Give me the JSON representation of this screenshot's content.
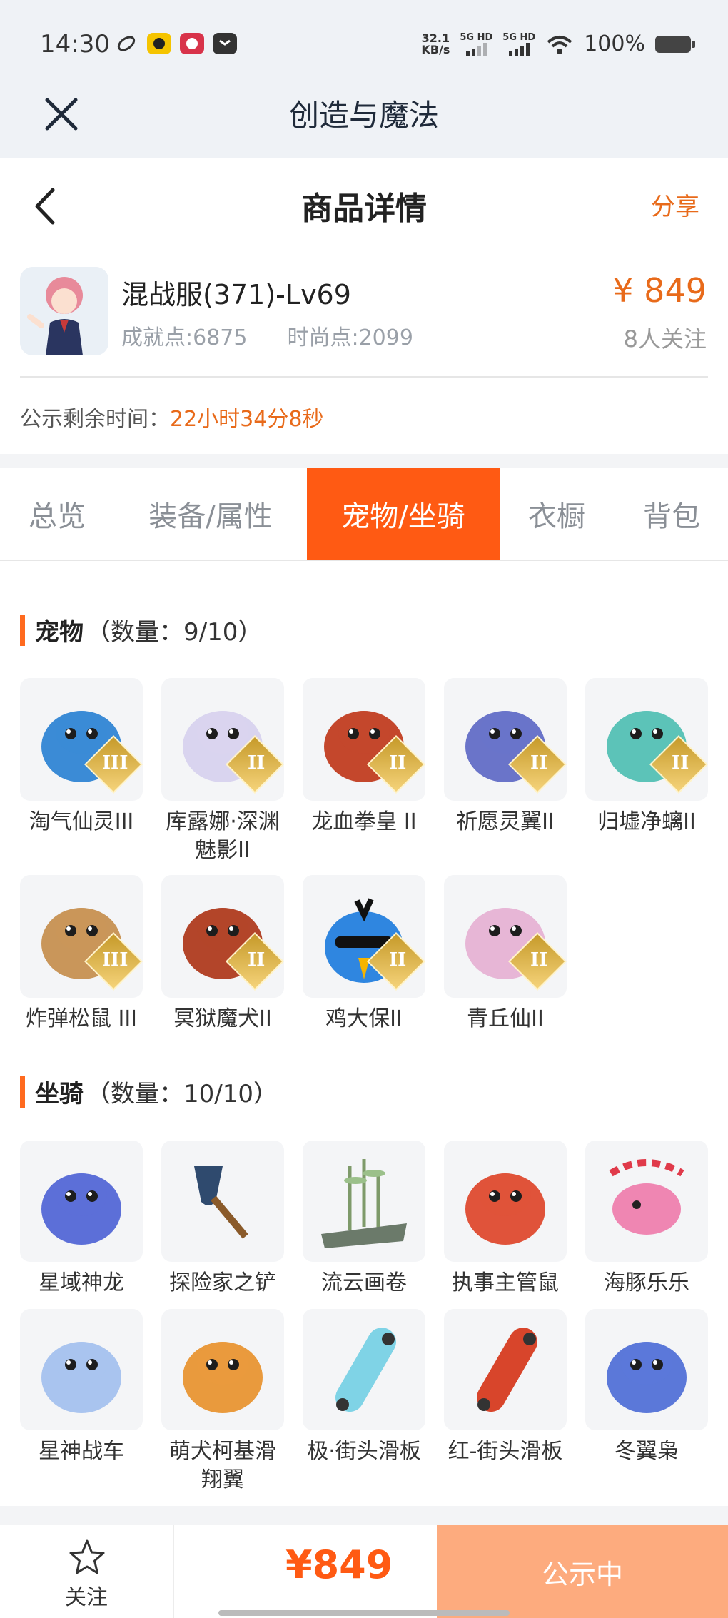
{
  "status_bar": {
    "time": "14:30",
    "net_speed_value": "32.1",
    "net_speed_unit": "KB/s",
    "sig1_label": "5G HD",
    "sig2_label": "5G HD",
    "battery": "100%"
  },
  "app_header": {
    "title": "创造与魔法"
  },
  "page_header": {
    "title": "商品详情",
    "share_label": "分享"
  },
  "product": {
    "name": "混战服(371)-Lv69",
    "achievement": "成就点:6875",
    "fashion": "时尚点:2099",
    "price": "¥ 849",
    "followers": "8人关注",
    "countdown_label": "公示剩余时间：",
    "countdown_value": "22小时34分8秒"
  },
  "tabs": [
    {
      "label": "总览"
    },
    {
      "label": "装备/属性"
    },
    {
      "label": "宠物/坐骑",
      "active": true
    },
    {
      "label": "衣橱"
    },
    {
      "label": "背包"
    }
  ],
  "pets": {
    "title": "宠物",
    "count": "（数量：9/10）",
    "items": [
      {
        "name": "淘气仙灵III",
        "tier": "III",
        "icon": "blue-puppy",
        "color": "#3b8bd6"
      },
      {
        "name": "库露娜·深渊魅影II",
        "tier": "II",
        "icon": "white-spirit-girl",
        "color": "#d9d4ef"
      },
      {
        "name": "龙血拳皇 II",
        "tier": "II",
        "icon": "red-dragon-fighter",
        "color": "#c4472c"
      },
      {
        "name": "祈愿灵翼II",
        "tier": "II",
        "icon": "blue-eagle",
        "color": "#6a74c9"
      },
      {
        "name": "归墟净螭II",
        "tier": "II",
        "icon": "cyan-dragon",
        "color": "#5cc3b8"
      },
      {
        "name": "炸弹松鼠 III",
        "tier": "III",
        "icon": "squirrel",
        "color": "#c9965a"
      },
      {
        "name": "冥狱魔犬II",
        "tier": "II",
        "icon": "hell-hound",
        "color": "#b3452a"
      },
      {
        "name": "鸡大保II",
        "tier": "II",
        "icon": "blue-bird-sunglasses",
        "color": "#2f86e0"
      },
      {
        "name": "青丘仙II",
        "tier": "II",
        "icon": "fox-fairy",
        "color": "#e7b6d6"
      }
    ]
  },
  "mounts": {
    "title": "坐骑",
    "count": "（数量：10/10）",
    "items": [
      {
        "name": "星域神龙",
        "icon": "star-dragon",
        "color": "#5c6fd8"
      },
      {
        "name": "探险家之铲",
        "icon": "shovel",
        "color": "#2f4a6e"
      },
      {
        "name": "流云画卷",
        "icon": "bamboo-scroll",
        "color": "#7e9a6a"
      },
      {
        "name": "执事主管鼠",
        "icon": "butler-rat",
        "color": "#e0533a"
      },
      {
        "name": "海豚乐乐",
        "icon": "pink-dolphin",
        "color": "#ef86b2"
      },
      {
        "name": "星神战车",
        "icon": "pegasus-chariot",
        "color": "#a9c4ef"
      },
      {
        "name": "萌犬柯基滑翔翼",
        "icon": "corgi-glider",
        "color": "#e99a3d"
      },
      {
        "name": "极·街头滑板",
        "icon": "skateboard-blue",
        "color": "#7fd3e6"
      },
      {
        "name": "红-街头滑板",
        "icon": "skateboard-red",
        "color": "#d8452b"
      },
      {
        "name": "冬翼枭",
        "icon": "snow-owl",
        "color": "#5b78d9"
      }
    ]
  },
  "bottom": {
    "follow_label": "关注",
    "price": "¥849",
    "status_label": "公示中"
  },
  "colors": {
    "accent": "#ff5a13",
    "price": "#e86a1a"
  }
}
